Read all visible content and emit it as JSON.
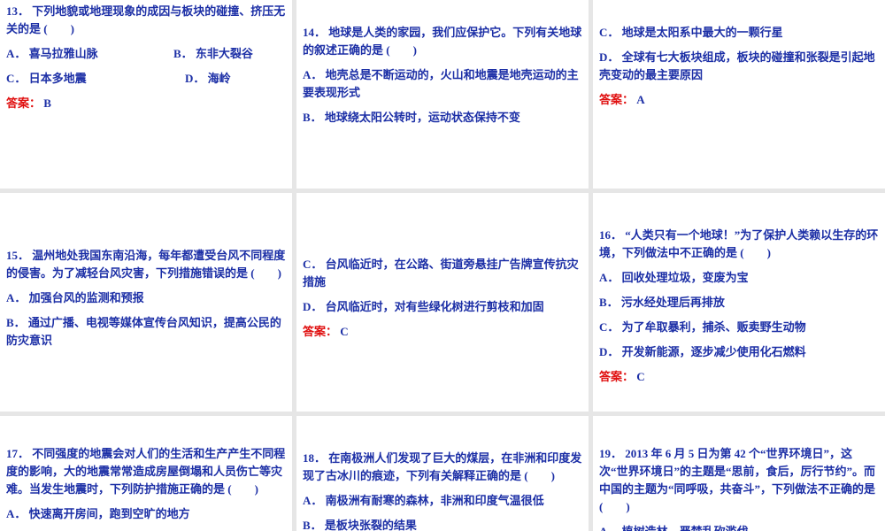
{
  "answer_label": "答案：",
  "panels": [
    {
      "q": "13． 下列地貌或地理现象的成因与板块的碰撞、挤压无关的是 (　　)",
      "A": "A． 喜马拉雅山脉",
      "B": "B． 东非大裂谷",
      "C": "C． 日本多地震",
      "D": "D． 海岭",
      "answer": "B"
    },
    {
      "q": "14． 地球是人类的家园，我们应保护它。下列有关地球的叙述正确的是 (　　)",
      "A": "A． 地壳总是不断运动的，火山和地震是地壳运动的主要表现形式",
      "B": "B． 地球绕太阳公转时，运动状态保持不变"
    },
    {
      "C": "C． 地球是太阳系中最大的一颗行星",
      "D": "D． 全球有七大板块组成，板块的碰撞和张裂是引起地壳变动的最主要原因",
      "answer": "A"
    },
    {
      "q": "15． 温州地处我国东南沿海，每年都遭受台风不同程度的侵害。为了减轻台风灾害，下列措施错误的是 (　　)",
      "A": "A． 加强台风的监测和预报",
      "B": "B． 通过广播、电视等媒体宣传台风知识，提高公民的防灾意识"
    },
    {
      "C": "C． 台风临近时，在公路、街道旁悬挂广告牌宣传抗灾措施",
      "D": "D． 台风临近时，对有些绿化树进行剪枝和加固",
      "answer": "C"
    },
    {
      "q": "16． “人类只有一个地球！”为了保护人类赖以生存的环境，下列做法中不正确的是 (　　)",
      "A": "A． 回收处理垃圾，变废为宝",
      "B": "B． 污水经处理后再排放",
      "C": "C． 为了牟取暴利，捕杀、贩卖野生动物",
      "D": "D． 开发新能源，逐步减少使用化石燃料",
      "answer": "C"
    },
    {
      "q": "17． 不同强度的地震会对人们的生活和生产产生不同程度的影响，大的地震常常造成房屋倒塌和人员伤亡等灾难。当发生地震时，下列防护措施正确的是 (　　)",
      "A": "A． 快速离开房间，跑到空旷的地方"
    },
    {
      "q": "18． 在南极洲人们发现了巨大的煤层，在非洲和印度发现了古冰川的痕迹，下列有关解释正确的是 (　　)",
      "A": "A． 南极洲有耐寒的森林，非洲和印度气温很低",
      "B": "B． 是板块张裂的结果"
    },
    {
      "q": "19． 2013 年 6 月 5 日为第 42 个“世界环境日”，这次“世界环境日”的主题是“思前，食后，厉行节约”。而中国的主题为“同呼吸，共奋斗”，下列做法不正确的是 (　　)",
      "A": "A． 植树造林，严禁乱砍滥伐"
    }
  ]
}
